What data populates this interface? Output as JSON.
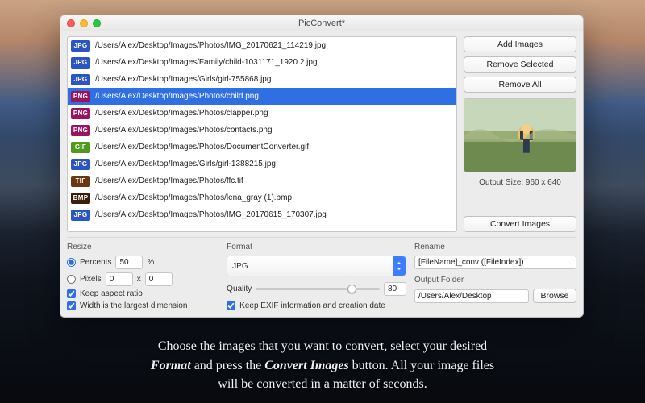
{
  "window": {
    "title": "PicConvert*"
  },
  "icons": {
    "close": "close-icon",
    "minimize": "minimize-icon",
    "zoom": "zoom-icon"
  },
  "list": {
    "items": [
      {
        "type": "JPG",
        "badge": "b-jpg",
        "path": "/Users/Alex/Desktop/Images/Photos/IMG_20170621_114219.jpg",
        "selected": false
      },
      {
        "type": "JPG",
        "badge": "b-jpg",
        "path": "/Users/Alex/Desktop/Images/Family/child-1031171_1920 2.jpg",
        "selected": false
      },
      {
        "type": "JPG",
        "badge": "b-jpg",
        "path": "/Users/Alex/Desktop/Images/Girls/girl-755868.jpg",
        "selected": false
      },
      {
        "type": "PNG",
        "badge": "b-png",
        "path": "/Users/Alex/Desktop/Images/Photos/child.png",
        "selected": true
      },
      {
        "type": "PNG",
        "badge": "b-png",
        "path": "/Users/Alex/Desktop/Images/Photos/clapper.png",
        "selected": false
      },
      {
        "type": "PNG",
        "badge": "b-png",
        "path": "/Users/Alex/Desktop/Images/Photos/contacts.png",
        "selected": false
      },
      {
        "type": "GIF",
        "badge": "b-gif",
        "path": "/Users/Alex/Desktop/Images/Photos/DocumentConverter.gif",
        "selected": false
      },
      {
        "type": "JPG",
        "badge": "b-jpg",
        "path": "/Users/Alex/Desktop/Images/Girls/girl-1388215.jpg",
        "selected": false
      },
      {
        "type": "TIF",
        "badge": "b-tif",
        "path": "/Users/Alex/Desktop/Images/Photos/ffc.tif",
        "selected": false
      },
      {
        "type": "BMP",
        "badge": "b-bmp",
        "path": "/Users/Alex/Desktop/Images/Photos/lena_gray (1).bmp",
        "selected": false
      },
      {
        "type": "JPG",
        "badge": "b-jpg",
        "path": "/Users/Alex/Desktop/Images/Photos/IMG_20170615_170307.jpg",
        "selected": false
      }
    ]
  },
  "side": {
    "add": "Add Images",
    "remove_selected": "Remove Selected",
    "remove_all": "Remove All",
    "output_size": "Output Size: 960 x 640",
    "convert": "Convert Images"
  },
  "resize": {
    "label": "Resize",
    "percents_label": "Percents",
    "percents_value": "50",
    "percent_sign": "%",
    "pixels_label": "Pixels",
    "pixels_w": "0",
    "pixels_x": "x",
    "pixels_h": "0",
    "keep_aspect": "Keep aspect ratio",
    "width_largest": "Width is the largest dimension",
    "percents_checked": true,
    "pixels_checked": false,
    "keep_checked": true,
    "width_checked": true
  },
  "format": {
    "label": "Format",
    "selected": "JPG",
    "quality_label": "Quality",
    "quality_value": "80",
    "keep_exif": "Keep EXIF information and creation date",
    "keep_exif_checked": true
  },
  "rename": {
    "label": "Rename",
    "value": "[FileName]_conv ([FileIndex])"
  },
  "output": {
    "label": "Output Folder",
    "value": "/Users/Alex/Desktop",
    "browse": "Browse"
  },
  "caption": {
    "p1a": "Choose the images that you want to convert, select your desired",
    "p1b_em": "Format",
    "p1c": " and press the ",
    "p1d_em": "Convert Images",
    "p1e": " button. All your image files",
    "p2": "will be converted in a matter of seconds."
  }
}
